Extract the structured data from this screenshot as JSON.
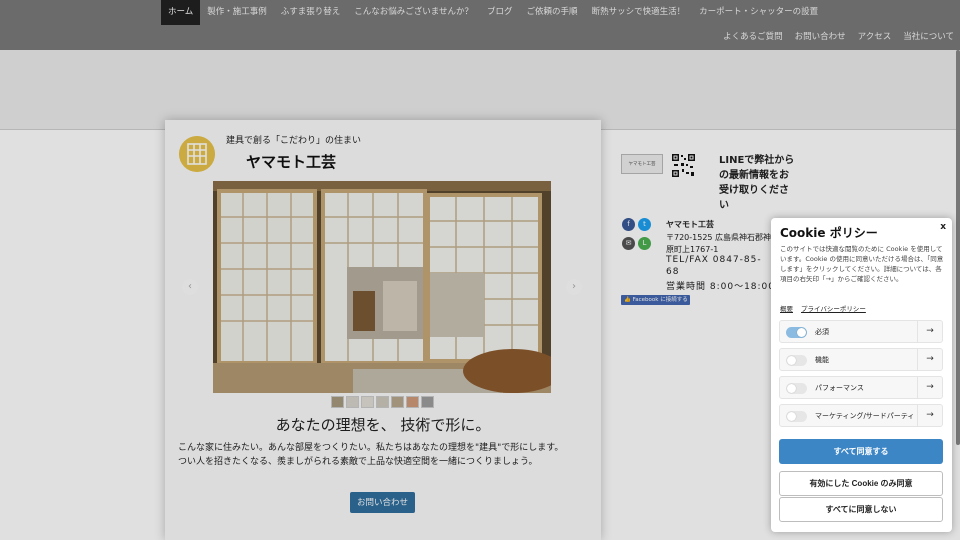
{
  "nav": {
    "row1": [
      "ホーム",
      "製作・施工事例",
      "ふすま張り替え",
      "こんなお悩みございませんか？",
      "ブログ",
      "ご依頼の手順",
      "断熱サッシで快適生活！",
      "カーポート・シャッターの設置"
    ],
    "row2": [
      "よくあるご質問",
      "お問い合わせ",
      "アクセス",
      "当社について"
    ],
    "active_index": 0
  },
  "hero": {
    "tagline": "建具で創る「こだわり」の住まい",
    "brand": "ヤマモト工芸",
    "slider_prev": "‹",
    "slider_next": "›",
    "thumb_count": 7,
    "headline": "あなたの理想を、 技術で形に。",
    "body_line1": "こんな家に住みたい。あんな部屋をつくりたい。私たちはあなたの理想を\"建具\"で形にします。",
    "body_line2": "つい人を招きたくなる、羨ましがられる素敵で上品な快適空間を一緒につくりましょう。",
    "contact_button": "お問い合わせ"
  },
  "sidebar": {
    "mini_logo": "ヤマモト工芸",
    "line_text": "LINEで弊社からの最新情報をお受け取りください",
    "company_name": "ヤマモト工芸",
    "address1": "〒720-1525  広島県神石郡神石高原町",
    "address2": "原町上1767-1",
    "tel": "TEL/FAX 0847-85-",
    "tel2": "68",
    "hours": "営業時間 8:00〜18:00",
    "facebook_button": "👍 Facebook に接続する",
    "social": [
      {
        "icon": "f",
        "color": "#3b5998"
      },
      {
        "icon": "t",
        "color": "#1da1f2"
      },
      {
        "icon": "✉",
        "color": "#555555"
      },
      {
        "icon": "L",
        "color": "#4caf50"
      }
    ]
  },
  "cookie": {
    "title": "Cookie ポリシー",
    "close": "x",
    "description": "このサイトでは快適な閲覧のために Cookie を使用しています。Cookie の使用に同意いただける場合は、「同意します」をクリックしてください。詳細については、各項目の右矢印「→」からご確認ください。",
    "link_summary": "概要",
    "link_privacy": "プライバシーポリシー",
    "preferences": [
      {
        "label": "必須",
        "on": true
      },
      {
        "label": "機能",
        "on": false
      },
      {
        "label": "パフォーマンス",
        "on": false
      },
      {
        "label": "マーケティング/サードパーティ",
        "on": false
      }
    ],
    "pref_arrow": "→",
    "accept_all": "すべて同意する",
    "accept_selected": "有効にした Cookie のみ同意",
    "reject_all": "すべてに同意しない"
  }
}
